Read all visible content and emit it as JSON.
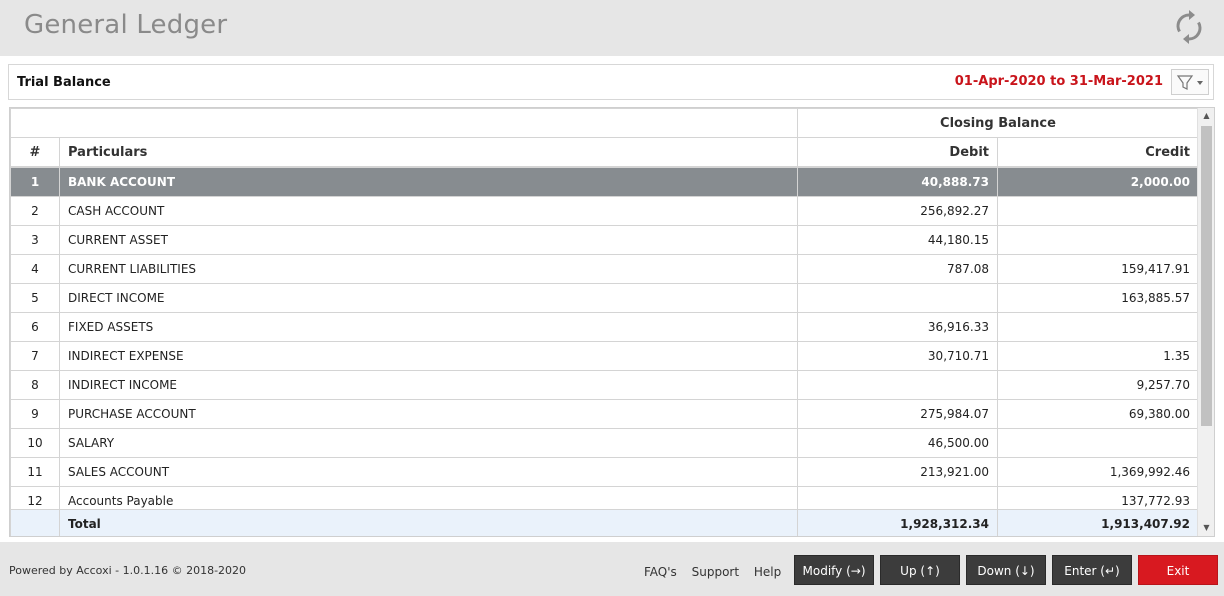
{
  "app": {
    "title": "General Ledger"
  },
  "report": {
    "title": "Trial Balance",
    "period": "01-Apr-2020 to 31-Mar-2021"
  },
  "table": {
    "group_header": "Closing Balance",
    "columns": {
      "num": "#",
      "particulars": "Particulars",
      "debit": "Debit",
      "credit": "Credit"
    },
    "rows": [
      {
        "num": "1",
        "particulars": "BANK ACCOUNT",
        "debit": "40,888.73",
        "credit": "2,000.00"
      },
      {
        "num": "2",
        "particulars": "CASH ACCOUNT",
        "debit": "256,892.27",
        "credit": ""
      },
      {
        "num": "3",
        "particulars": "CURRENT ASSET",
        "debit": "44,180.15",
        "credit": ""
      },
      {
        "num": "4",
        "particulars": "CURRENT LIABILITIES",
        "debit": "787.08",
        "credit": "159,417.91"
      },
      {
        "num": "5",
        "particulars": "DIRECT INCOME",
        "debit": "",
        "credit": "163,885.57"
      },
      {
        "num": "6",
        "particulars": "FIXED ASSETS",
        "debit": "36,916.33",
        "credit": ""
      },
      {
        "num": "7",
        "particulars": "INDIRECT EXPENSE",
        "debit": "30,710.71",
        "credit": "1.35"
      },
      {
        "num": "8",
        "particulars": "INDIRECT INCOME",
        "debit": "",
        "credit": "9,257.70"
      },
      {
        "num": "9",
        "particulars": "PURCHASE ACCOUNT",
        "debit": "275,984.07",
        "credit": "69,380.00"
      },
      {
        "num": "10",
        "particulars": "SALARY",
        "debit": "46,500.00",
        "credit": ""
      },
      {
        "num": "11",
        "particulars": "SALES ACCOUNT",
        "debit": "213,921.00",
        "credit": "1,369,992.46"
      },
      {
        "num": "12",
        "particulars": "Accounts Payable",
        "debit": "",
        "credit": "137,772.93"
      }
    ],
    "total": {
      "label": "Total",
      "debit": "1,928,312.34",
      "credit": "1,913,407.92"
    }
  },
  "footer": {
    "powered": "Powered by Accoxi - 1.0.1.16 © 2018-2020",
    "links": [
      "FAQ's",
      "Support",
      "Help"
    ],
    "buttons": {
      "modify": "Modify (→)",
      "up": "Up (↑)",
      "down": "Down (↓)",
      "enter": "Enter (↵)",
      "exit": "Exit"
    }
  },
  "colors": {
    "period": "#c9141b",
    "selected_row": "#878c90",
    "exit_button": "#d81920",
    "total_row": "#eaf2fb"
  },
  "icons": {
    "refresh": "refresh-icon",
    "filter": "filter-icon"
  }
}
